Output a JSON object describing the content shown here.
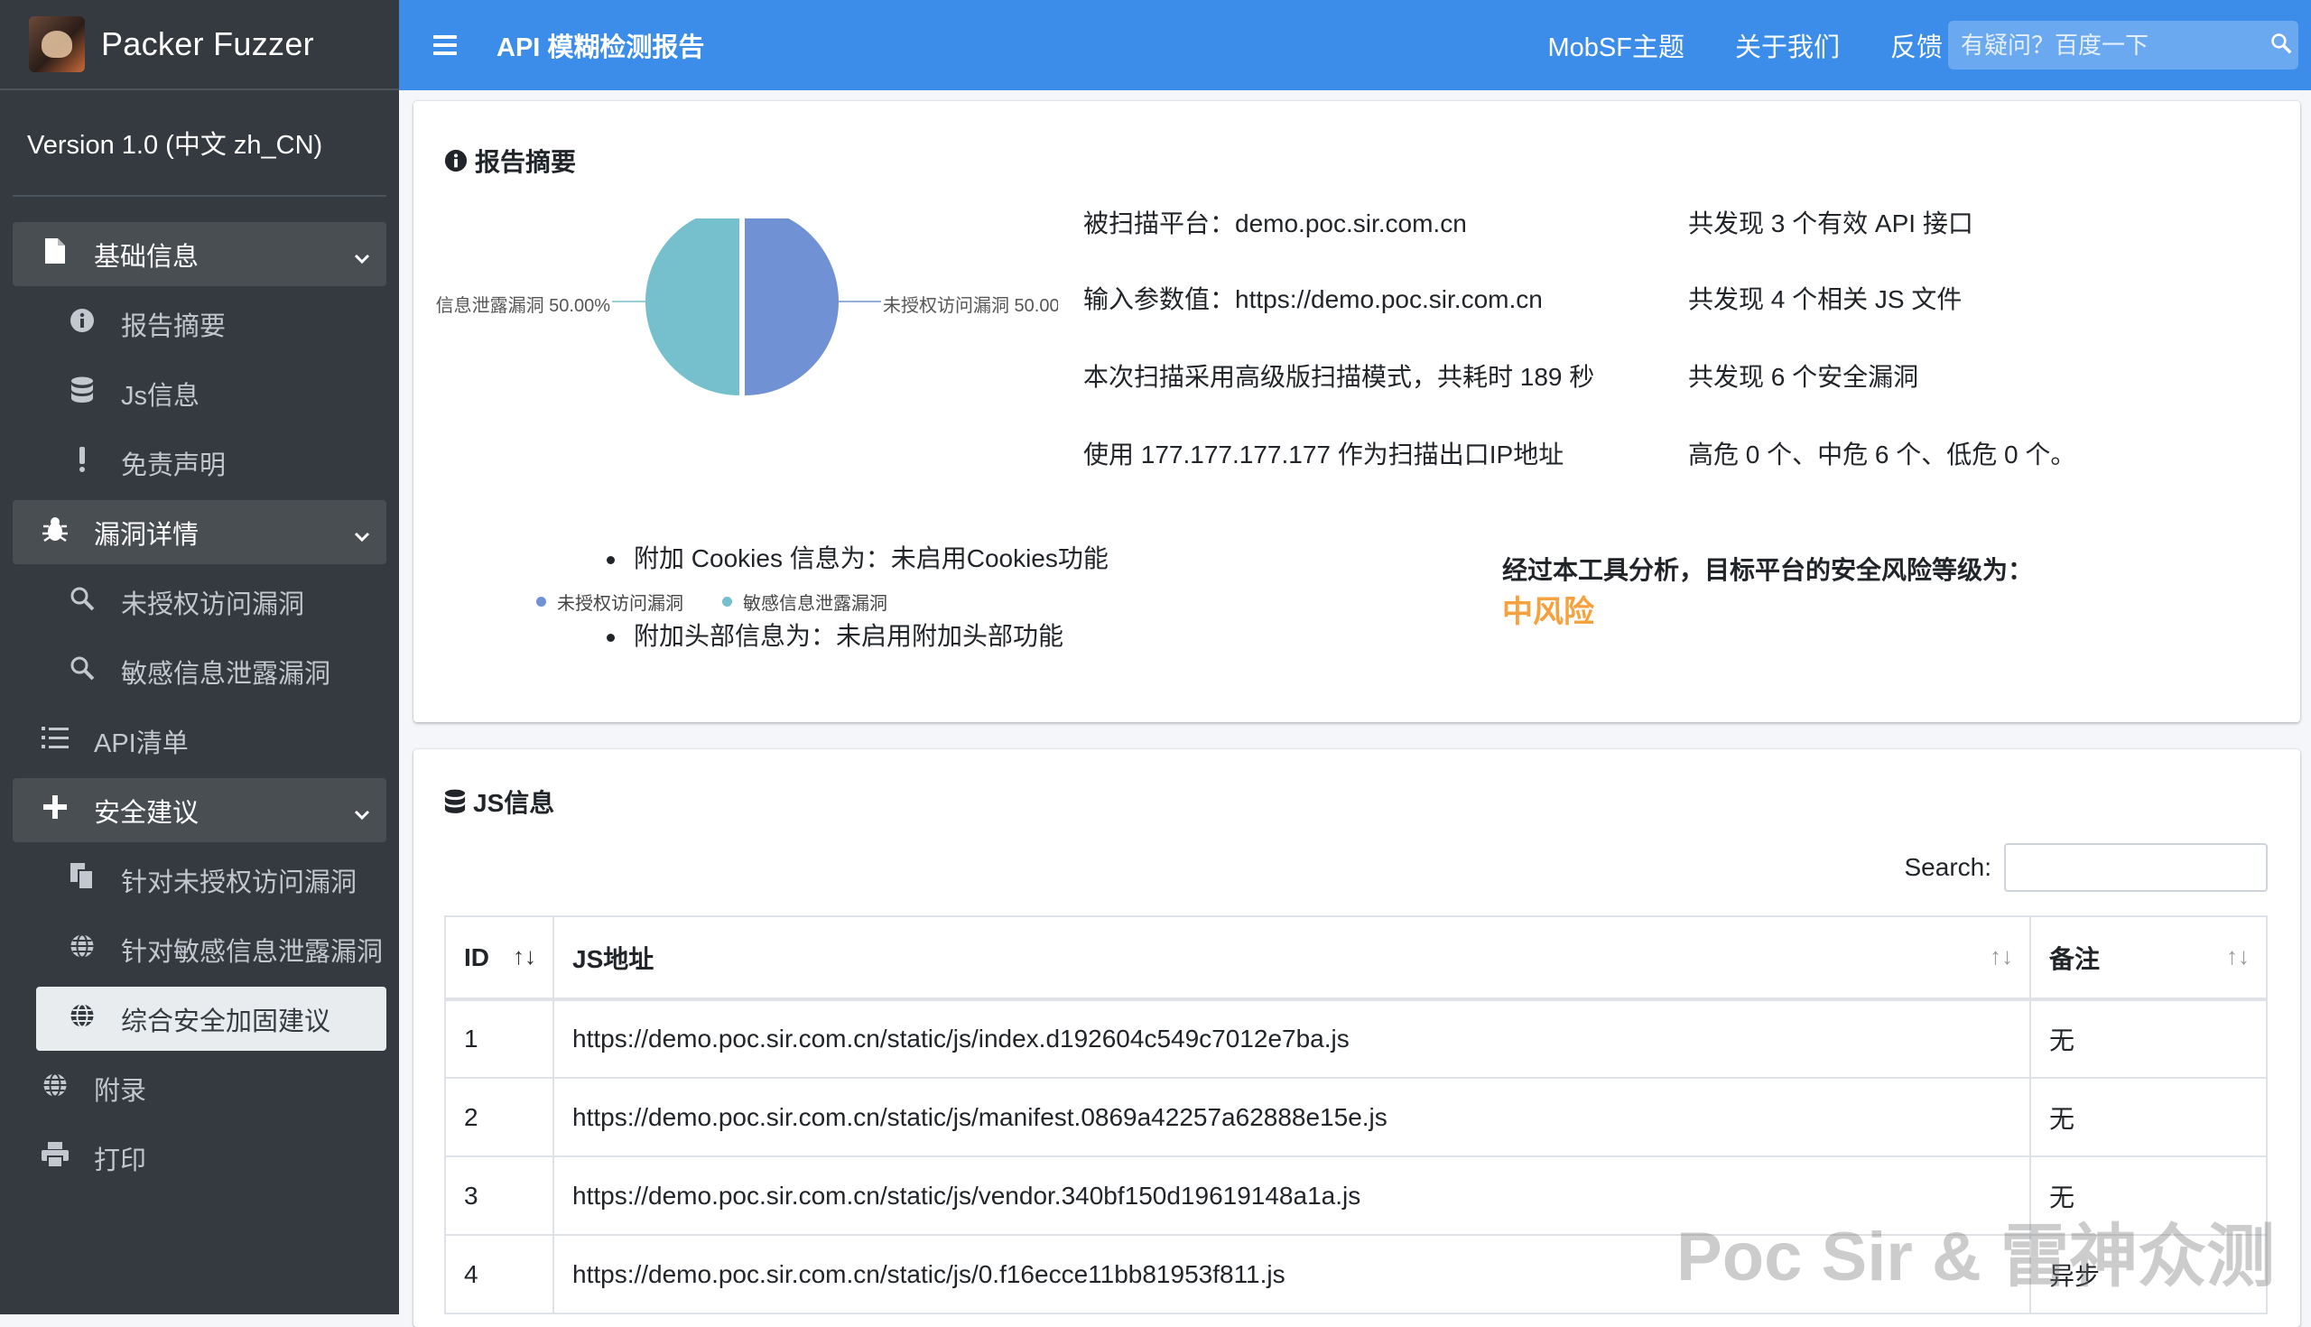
{
  "brand": {
    "name": "Packer Fuzzer"
  },
  "version": "Version 1.0 (中文 zh_CN)",
  "sidebar": {
    "items": [
      {
        "label": "基础信息",
        "icon": "file-icon",
        "type": "group"
      },
      {
        "label": "报告摘要",
        "icon": "info-circle-icon",
        "type": "sub"
      },
      {
        "label": "Js信息",
        "icon": "database-icon",
        "type": "sub"
      },
      {
        "label": "免责声明",
        "icon": "exclamation-icon",
        "type": "sub"
      },
      {
        "label": "漏洞详情",
        "icon": "bug-icon",
        "type": "group"
      },
      {
        "label": "未授权访问漏洞",
        "icon": "search-icon",
        "type": "sub"
      },
      {
        "label": "敏感信息泄露漏洞",
        "icon": "search-icon",
        "type": "sub"
      },
      {
        "label": "API清单",
        "icon": "list-icon",
        "type": "top"
      },
      {
        "label": "安全建议",
        "icon": "plus-icon",
        "type": "group"
      },
      {
        "label": "针对未授权访问漏洞",
        "icon": "copy-icon",
        "type": "sub"
      },
      {
        "label": "针对敏感信息泄露漏洞",
        "icon": "globe-icon",
        "type": "sub"
      },
      {
        "label": "综合安全加固建议",
        "icon": "globe-icon",
        "type": "sub-active"
      },
      {
        "label": "附录",
        "icon": "globe-icon",
        "type": "top"
      },
      {
        "label": "打印",
        "icon": "print-icon",
        "type": "top"
      }
    ]
  },
  "topbar": {
    "title": "API 模糊检测报告",
    "links": [
      "MobSF主题",
      "关于我们",
      "反馈"
    ],
    "search_placeholder": "有疑问？百度一下"
  },
  "summary": {
    "title": "报告摘要",
    "platform": "被扫描平台：demo.poc.sir.com.cn",
    "input": "输入参数值：https://demo.poc.sir.com.cn",
    "mode": "本次扫描采用高级版扫描模式，共耗时 189 秒",
    "ip": "使用 177.177.177.177 作为扫描出口IP地址",
    "api_count": "共发现 3 个有效 API 接口",
    "js_count": "共发现 4 个相关 JS 文件",
    "vuln_count": "共发现 6 个安全漏洞",
    "levels": "高危 0 个、中危 6 个、低危 0 个。",
    "cookies": "附加 Cookies 信息为：未启用Cookies功能",
    "headers": "附加头部信息为：未启用附加头部功能",
    "risk_title": "经过本工具分析，目标平台的安全风险等级为：",
    "risk_level": "中风险",
    "risk_color": "#f6a13b"
  },
  "chart_data": {
    "type": "pie",
    "series": [
      {
        "name": "未授权访问漏洞",
        "value": 50.0,
        "label": "未授权访问漏洞 50.00",
        "color": "#7092d4"
      },
      {
        "name": "敏感信息泄露漏洞",
        "value": 50.0,
        "label": "信息泄露漏洞 50.00%",
        "color": "#76bfcc"
      }
    ],
    "legend": [
      "未授权访问漏洞",
      "敏感信息泄露漏洞"
    ],
    "legend_position": "bottom"
  },
  "jsinfo": {
    "title": "JS信息",
    "search_label": "Search:",
    "columns": [
      "ID",
      "JS地址",
      "备注"
    ],
    "rows": [
      {
        "id": "1",
        "url": "https://demo.poc.sir.com.cn/static/js/index.d192604c549c7012e7ba.js",
        "note": "无"
      },
      {
        "id": "2",
        "url": "https://demo.poc.sir.com.cn/static/js/manifest.0869a42257a62888e15e.js",
        "note": "无"
      },
      {
        "id": "3",
        "url": "https://demo.poc.sir.com.cn/static/js/vendor.340bf150d19619148a1a.js",
        "note": "无"
      },
      {
        "id": "4",
        "url": "https://demo.poc.sir.com.cn/static/js/0.f16ecce11bb81953f811.js",
        "note": "异步"
      }
    ]
  },
  "watermark": "Poc Sir & 雷神众测"
}
